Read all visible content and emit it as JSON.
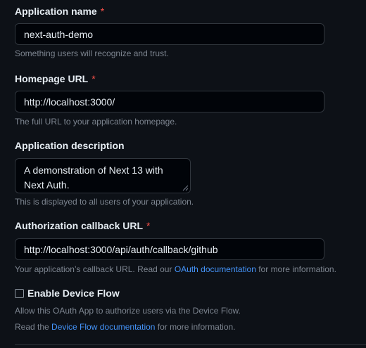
{
  "app_name": {
    "label": "Application name",
    "required": "*",
    "value": "next-auth-demo",
    "hint": "Something users will recognize and trust."
  },
  "homepage_url": {
    "label": "Homepage URL",
    "required": "*",
    "value": "http://localhost:3000/",
    "hint": "The full URL to your application homepage."
  },
  "description": {
    "label": "Application description",
    "value": "A demonstration of Next 13 with Next Auth.",
    "hint": "This is displayed to all users of your application."
  },
  "callback_url": {
    "label": "Authorization callback URL",
    "required": "*",
    "value": "http://localhost:3000/api/auth/callback/github",
    "hint_prefix": "Your application’s callback URL. Read our ",
    "hint_link": "OAuth documentation",
    "hint_suffix": " for more information."
  },
  "device_flow": {
    "label": "Enable Device Flow",
    "checked": false,
    "description": "Allow this OAuth App to authorize users via the Device Flow.",
    "read_prefix": "Read the ",
    "read_link": "Device Flow documentation",
    "read_suffix": " for more information."
  },
  "colors": {
    "background": "#0d1117",
    "input_background": "#010409",
    "border": "#30363d",
    "required": "#f85149",
    "link": "#4493f8",
    "muted": "#7d8590"
  }
}
